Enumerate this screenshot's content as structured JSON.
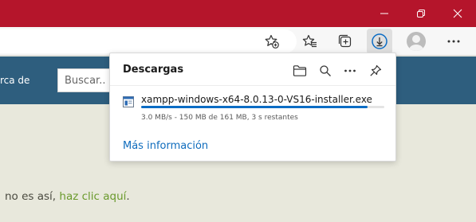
{
  "page": {
    "search_label": "rca de",
    "search_placeholder": "Buscar..",
    "body_prefix": "no es así, ",
    "body_link": "haz clic aquí",
    "body_suffix": "."
  },
  "downloads": {
    "title": "Descargas",
    "item": {
      "filename": "xampp-windows-x64-8.0.13-0-VS16-installer.exe",
      "status": "3.0 MB/s - 150 MB de 161 MB, 3 s restantes",
      "progress": 0.93
    },
    "more_info": "Más información"
  },
  "colors": {
    "titlebar": "#b5152b",
    "site_header": "#2e5e7e",
    "page_background": "#e8e8dc",
    "link_green": "#6a9a2c",
    "accent_blue": "#0b6cc4"
  },
  "icons": {
    "window": [
      "minimize-icon",
      "restore-icon",
      "close-icon"
    ],
    "toolbar": [
      "add-favorite-icon",
      "favorites-icon",
      "collections-icon",
      "downloads-icon",
      "profile-icon",
      "more-icon"
    ],
    "flyout": [
      "folder-icon",
      "search-icon",
      "more-icon",
      "pin-icon",
      "file-icon"
    ]
  }
}
